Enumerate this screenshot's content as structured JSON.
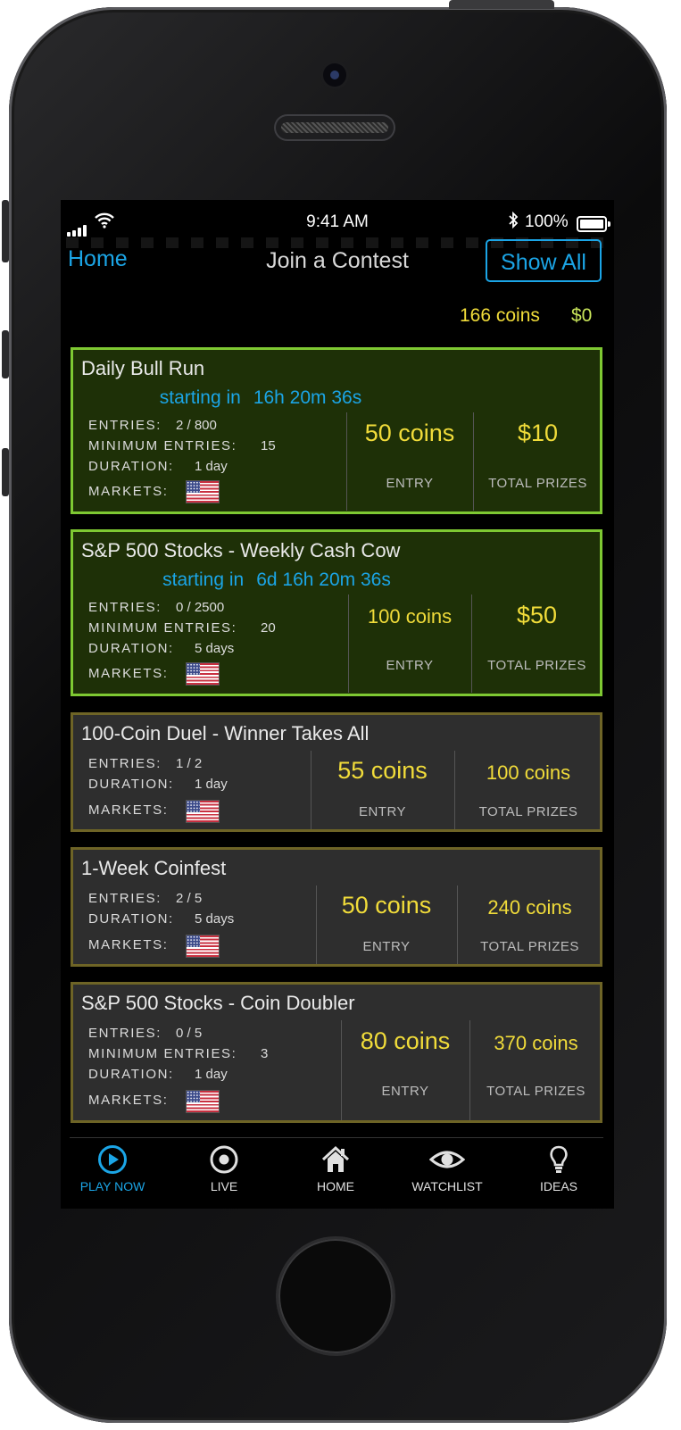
{
  "status": {
    "time": "9:41 AM",
    "battery": "100%"
  },
  "nav": {
    "back_label": "Home",
    "title": "Join a Contest",
    "show_all_label": "Show All"
  },
  "balance": {
    "coins": "166 coins",
    "cash": "$0"
  },
  "labels": {
    "entries": "ENTRIES:",
    "minimum_entries": "MINIMUM ENTRIES:",
    "duration": "DURATION:",
    "markets": "MARKETS:",
    "entry": "ENTRY",
    "total_prizes": "TOTAL PRIZES",
    "starting_in": "starting in"
  },
  "contests": [
    {
      "title": "Daily Bull Run",
      "countdown": "16h 20m 36s",
      "entries": "2 / 800",
      "minimum_entries": "15",
      "duration": "1 day",
      "entry_fee": "50 coins",
      "prize": "$10"
    },
    {
      "title": "S&P 500 Stocks - Weekly Cash Cow",
      "countdown": "6d 16h 20m 36s",
      "entries": "0 / 2500",
      "minimum_entries": "20",
      "duration": "5 days",
      "entry_fee": "100 coins",
      "prize": "$50"
    },
    {
      "title": "100-Coin Duel - Winner Takes All",
      "entries": "1 / 2",
      "duration": "1 day",
      "entry_fee": "55 coins",
      "prize": "100 coins"
    },
    {
      "title": "1-Week Coinfest",
      "entries": "2 / 5",
      "duration": "5 days",
      "entry_fee": "50 coins",
      "prize": "240 coins"
    },
    {
      "title": "S&P 500 Stocks - Coin Doubler",
      "entries": "0 / 5",
      "minimum_entries": "3",
      "duration": "1 day",
      "entry_fee": "80 coins",
      "prize": "370 coins"
    }
  ],
  "tabs": [
    {
      "label": "PLAY NOW",
      "icon": "play-icon",
      "active": true
    },
    {
      "label": "LIVE",
      "icon": "target-icon"
    },
    {
      "label": "HOME",
      "icon": "house-icon"
    },
    {
      "label": "WATCHLIST",
      "icon": "eye-icon"
    },
    {
      "label": "IDEAS",
      "icon": "lightbulb-icon"
    }
  ],
  "colors": {
    "accent_blue": "#1ba5e6",
    "coin_yellow": "#f1dc3a",
    "cash_green": "#c8e45a",
    "featured_border": "#7ec832",
    "standard_border": "#6e6426"
  }
}
